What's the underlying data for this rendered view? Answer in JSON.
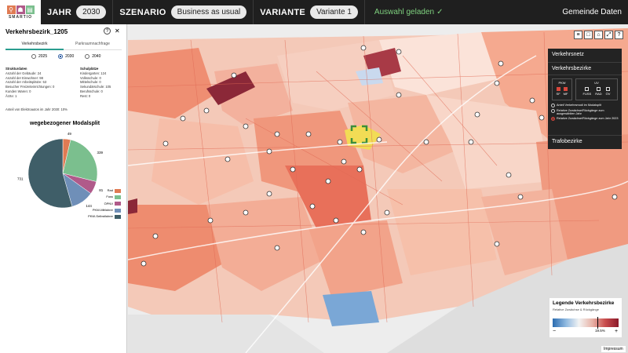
{
  "topbar": {
    "logo_word": "SMARTIO",
    "year_label": "JAHR",
    "year_value": "2030",
    "scenario_label": "SZENARIO",
    "scenario_value": "Business as usual",
    "variant_label": "VARIANTE",
    "variant_value": "Variante 1",
    "status": "Auswahl geladen",
    "status_icon": "check-icon",
    "right_label": "Gemeinde Daten"
  },
  "panel": {
    "title": "Verkehrsbezirk_1205",
    "tabs": [
      {
        "label": "Verkehrsbezirk",
        "active": true
      },
      {
        "label": "Parkraumnachfrage",
        "active": false
      }
    ],
    "years": [
      {
        "label": "2025",
        "selected": false
      },
      {
        "label": "2030",
        "selected": true
      },
      {
        "label": "2040",
        "selected": false
      }
    ],
    "struct_header": "Strukturdaten",
    "struct_lines": [
      "Anzahl der Gebäude: 24",
      "Anzahl der Einwohner: 98",
      "Anzahl der Arbeitsplätze: 53",
      "Besucher Freizeiteinrichtungen: 0",
      "Kunden Waren: 0",
      "Ärzte: 1"
    ],
    "school_header": "Schulplätze",
    "school_lines": [
      "Kindergarten: 124",
      "Volksschule: 0",
      "Mittelschule: 0",
      "Sekundärschule: 105",
      "Berufsschule: 0",
      "Rest: 0"
    ],
    "ebike_text": "Anteil von Elektroautos im Jahr 2030: 10%",
    "modal_title": "wegebezogener Modalsplit"
  },
  "chart_data": {
    "type": "pie",
    "title": "wegebezogener Modalsplit",
    "slices": [
      {
        "name": "Rad",
        "value": 49,
        "color": "#e07b53"
      },
      {
        "name": "Fuss",
        "value": 339,
        "color": "#7bbf8e"
      },
      {
        "name": "ÖPNV",
        "value": 81,
        "color": "#b05a8a"
      },
      {
        "name": "PKW-Mitfahrer",
        "value": 144,
        "color": "#6f8fb8"
      },
      {
        "name": "PKW-Selbstfahrer",
        "value": 731,
        "color": "#3f5e68"
      }
    ],
    "legend_placement": "bottom-right"
  },
  "layers": {
    "verkehrsnetz": "Verkehrsnetz",
    "verkehrsbezirke": "Verkehrsbezirke",
    "pkw_label": "PKW",
    "uv_label": "UV",
    "pkw_checks": [
      {
        "label": "SF",
        "on": true
      },
      {
        "label": "MF",
        "on": true
      }
    ],
    "uv_checks": [
      {
        "label": "FUSS",
        "on": false
      },
      {
        "label": "RAD",
        "on": false
      },
      {
        "label": "ÖV",
        "on": false
      }
    ],
    "options": [
      {
        "label": "Anteil Verkehrsmodi im Modalsplit",
        "selected": false
      },
      {
        "label": "Relative Zuwächse/Rückgänge zum ausgewählten Jahr",
        "selected": false
      },
      {
        "label": "Relative Zuwächse/Rückgänge zum Jahr 2023",
        "selected": true
      }
    ],
    "trafo": "Trafobezirke"
  },
  "map_legend": {
    "title": "Legende Verkehrsbezirke",
    "subtitle": "Relative Zuwächse & Rückgänge",
    "minus": "−",
    "value": "19.5%",
    "plus": "+"
  },
  "tools": [
    "layers-icon",
    "square-icon",
    "home-icon",
    "fullscreen-icon",
    "help-icon"
  ],
  "impressum": "Impressum"
}
